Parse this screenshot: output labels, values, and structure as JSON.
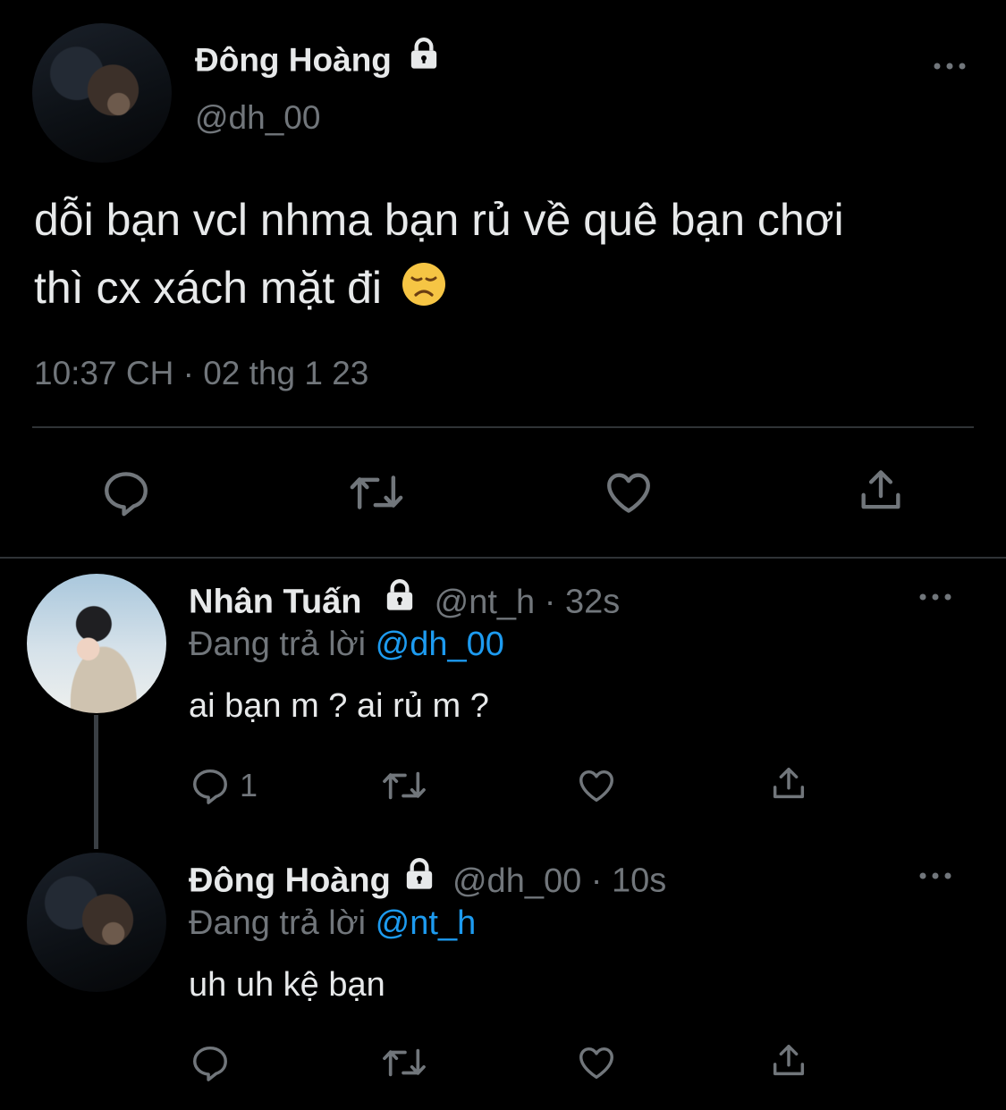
{
  "main_tweet": {
    "display_name": "Đông Hoàng",
    "handle": "@dh_00",
    "text_line1": "dỗi bạn vcl nhma bạn rủ về quê bạn chơi",
    "text_line2": "thì cx xách mặt đi",
    "emoji": "😞",
    "timestamp": "10:37 CH · 02 thg 1 23"
  },
  "reply1": {
    "display_name": "Nhân Tuấn",
    "handle": "@nt_h",
    "time": "· 32s",
    "replying_prefix": "Đang trả lời",
    "replying_to": "@dh_00",
    "text": "ai bạn m ? ai rủ m ?",
    "reply_count": "1"
  },
  "reply2": {
    "display_name": "Đông Hoàng",
    "handle": "@dh_00",
    "time": "· 10s",
    "replying_prefix": "Đang trả lời",
    "replying_to": "@nt_h",
    "text": "uh uh kệ bạn"
  },
  "icons": {
    "more": "more-icon",
    "reply": "reply-icon",
    "retweet": "retweet-icon",
    "like": "like-icon",
    "share": "share-icon",
    "lock": "lock-icon"
  },
  "colors": {
    "background": "#000000",
    "text": "#e7e9ea",
    "muted": "#71767b",
    "link": "#1d9bf0",
    "divider": "#2f3336"
  }
}
